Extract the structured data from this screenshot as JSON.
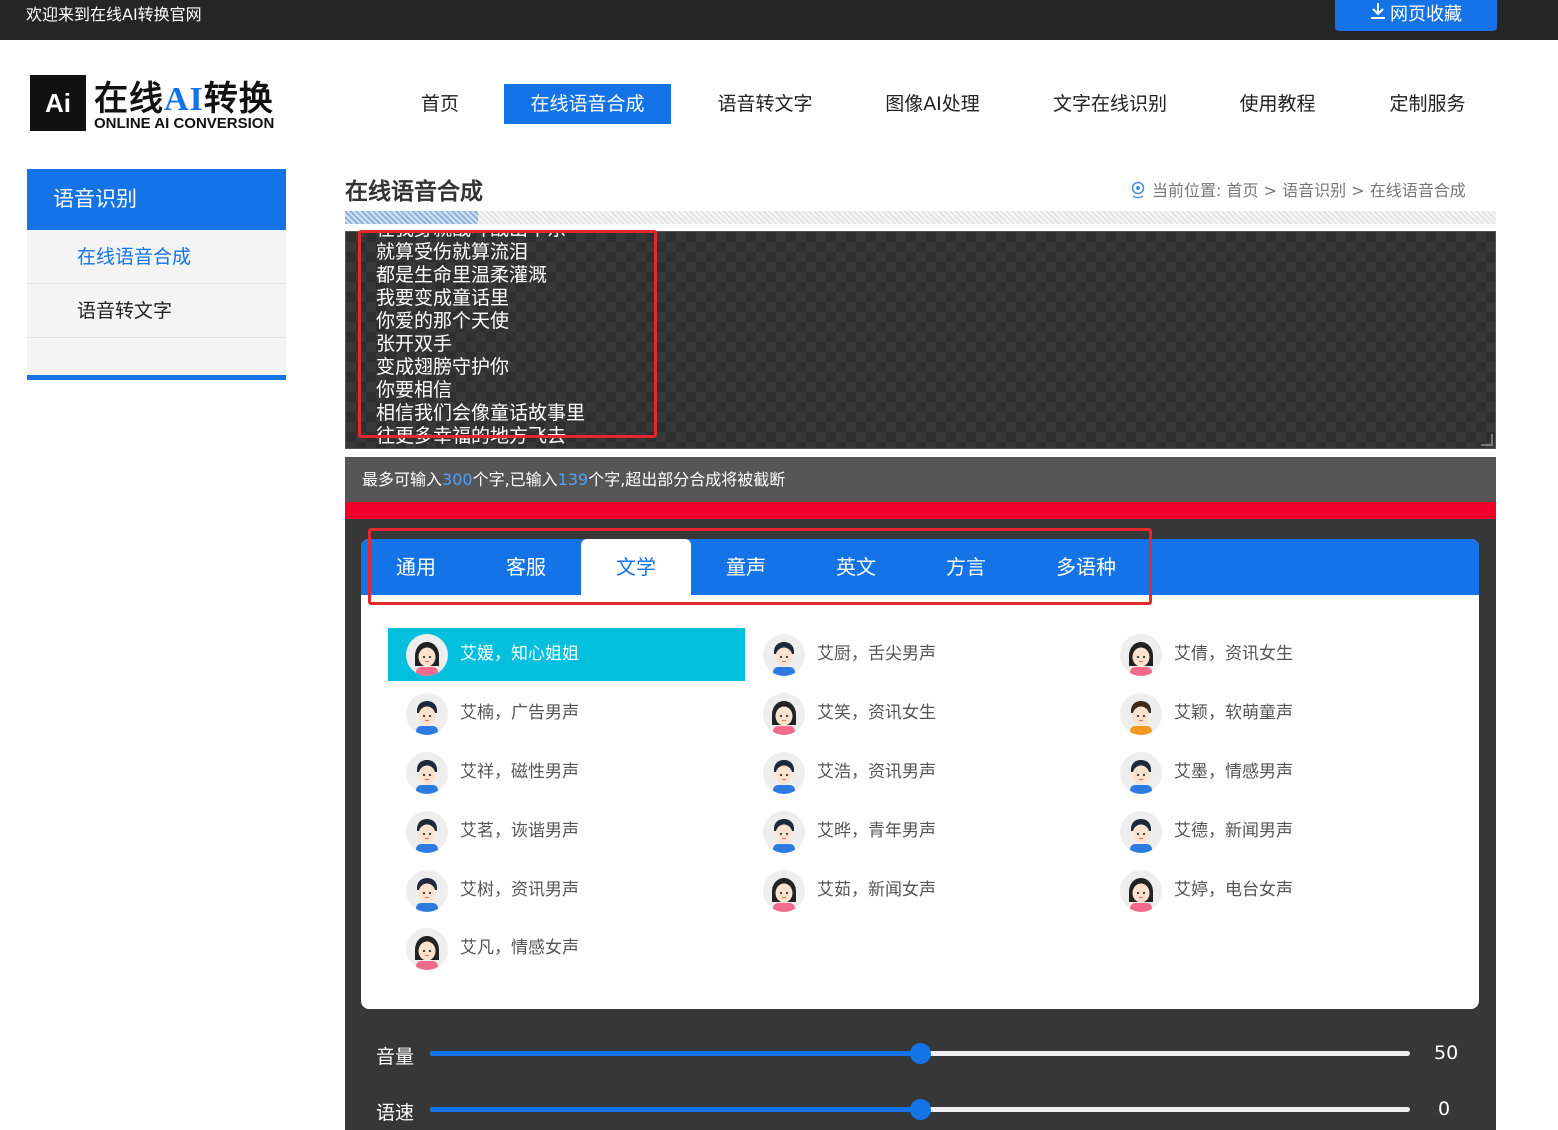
{
  "topbar": {
    "welcome": "欢迎来到在线AI转换官网",
    "bookmark": "网页收藏",
    "bookmark_icon": "download-icon"
  },
  "logo": {
    "mark": "Ai",
    "cn_prefix": "在线",
    "cn_ai": "AI",
    "cn_suffix": "转换",
    "en": "ONLINE AI CONVERSION"
  },
  "nav": [
    {
      "label": "首页",
      "active": false
    },
    {
      "label": "在线语音合成",
      "active": true
    },
    {
      "label": "语音转文字",
      "active": false
    },
    {
      "label": "图像AI处理",
      "active": false
    },
    {
      "label": "文字在线识别",
      "active": false
    },
    {
      "label": "使用教程",
      "active": false
    },
    {
      "label": "定制服务",
      "active": false
    }
  ],
  "sidebar": {
    "title": "语音识别",
    "items": [
      {
        "label": "在线语音合成",
        "active": true
      },
      {
        "label": "语音转文字",
        "active": false
      }
    ]
  },
  "main": {
    "title": "在线语音合成",
    "breadcrumb": {
      "prefix": "当前位置:",
      "home": "首页",
      "section": "语音识别",
      "current": "在线语音合成",
      "sep": ">"
    }
  },
  "editor": {
    "lines": [
      "在我身就战斗战出平东",
      "就算受伤就算流泪",
      "都是生命里温柔灌溉",
      "我要变成童话里",
      "你爱的那个天使",
      "张开双手",
      "变成翅膀守护你",
      "你要相信",
      "相信我们会像童话故事里",
      "往更多幸福的地方飞去"
    ]
  },
  "counter": {
    "p1": "最多可输入",
    "max": "300",
    "p2": "个字,已输入",
    "current": "139",
    "p3": "个字,超出部分合成将被截断"
  },
  "tabs": [
    {
      "label": "通用",
      "active": false
    },
    {
      "label": "客服",
      "active": false
    },
    {
      "label": "文学",
      "active": true
    },
    {
      "label": "童声",
      "active": false
    },
    {
      "label": "英文",
      "active": false
    },
    {
      "label": "方言",
      "active": false
    },
    {
      "label": "多语种",
      "active": false
    }
  ],
  "voices": [
    {
      "label": "艾媛，知心姐姐",
      "gender": "female",
      "active": true
    },
    {
      "label": "艾厨，舌尖男声",
      "gender": "male",
      "active": false
    },
    {
      "label": "艾倩，资讯女生",
      "gender": "female",
      "active": false
    },
    {
      "label": "艾楠，广告男声",
      "gender": "male",
      "active": false
    },
    {
      "label": "艾笑，资讯女生",
      "gender": "female",
      "active": false
    },
    {
      "label": "艾颖，软萌童声",
      "gender": "child",
      "active": false
    },
    {
      "label": "艾祥，磁性男声",
      "gender": "male",
      "active": false
    },
    {
      "label": "艾浩，资讯男声",
      "gender": "male",
      "active": false
    },
    {
      "label": "艾墨，情感男声",
      "gender": "male",
      "active": false
    },
    {
      "label": "艾茗，诙谐男声",
      "gender": "male",
      "active": false
    },
    {
      "label": "艾晔，青年男声",
      "gender": "male",
      "active": false
    },
    {
      "label": "艾德，新闻男声",
      "gender": "male",
      "active": false
    },
    {
      "label": "艾树，资讯男声",
      "gender": "male",
      "active": false
    },
    {
      "label": "艾茹，新闻女声",
      "gender": "female",
      "active": false
    },
    {
      "label": "艾婷，电台女声",
      "gender": "female",
      "active": false
    },
    {
      "label": "艾凡，情感女声",
      "gender": "female",
      "active": false
    }
  ],
  "sliders": {
    "volume": {
      "label": "音量",
      "value": "50",
      "fraction": 0.5
    },
    "speed": {
      "label": "语速",
      "value": "0",
      "fraction": 0.5
    }
  },
  "colors": {
    "accent": "#1473e6",
    "selected_voice": "#00c0de",
    "highlight_box": "#e5282b",
    "warning_bar": "#f0002a"
  }
}
